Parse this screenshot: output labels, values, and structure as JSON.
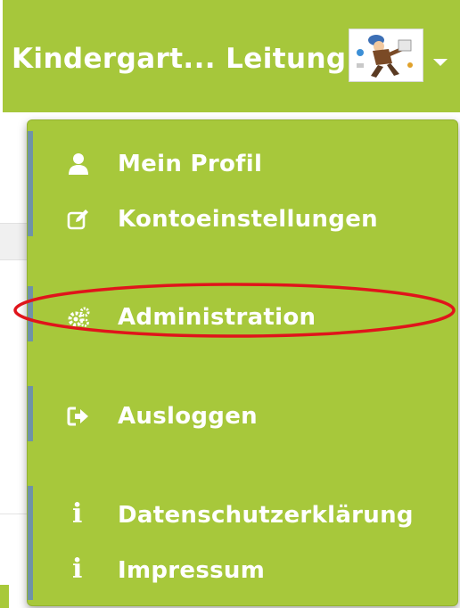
{
  "navbar": {
    "user_name": "Kindergart... Leitung",
    "avatar_icon": "cartoon-avatar",
    "caret_icon": "caret-down-icon"
  },
  "menu": {
    "items": [
      {
        "label": "Mein Profil",
        "icon": "user-icon"
      },
      {
        "label": "Kontoeinstellungen",
        "icon": "edit-icon"
      },
      {
        "label": "Administration",
        "icon": "cogs-icon"
      },
      {
        "label": "Ausloggen",
        "icon": "sign-out-icon"
      },
      {
        "label": "Datenschutzerklärung",
        "icon": "info-icon"
      },
      {
        "label": "Impressum",
        "icon": "info-icon"
      }
    ]
  },
  "colors": {
    "brand_green": "#a6c73b",
    "accent_blue": "#6f93a8",
    "highlight_red": "#e0141b"
  }
}
